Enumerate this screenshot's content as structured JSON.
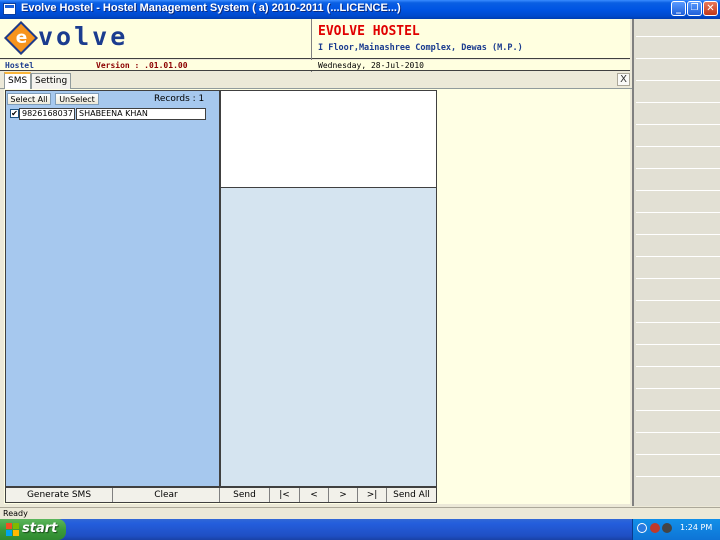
{
  "window": {
    "title": "Evolve Hostel - Hostel Management System ( a) 2010-2011 (...LICENCE...)",
    "minimize": "_",
    "maximize": "❐",
    "close": "✕"
  },
  "header": {
    "logo_initial": "e",
    "logo_text": "volve",
    "company_name": "EVOLVE HOSTEL",
    "company_address": "I Floor,Mainashree Complex, Dewas (M.P.)",
    "module": "Hostel",
    "version": "Version : .01.01.00",
    "date": "Wednesday, 28-Jul-2010"
  },
  "tabs": [
    {
      "label": "SMS",
      "active": true
    },
    {
      "label": "Setting",
      "active": false
    }
  ],
  "tab_close": "X",
  "recipients": {
    "select_all": "Select All",
    "unselect": "UnSelect",
    "records_text": "Records : 1",
    "items": [
      {
        "checked": "✔",
        "phone": "9826168037",
        "name": "SHABEENA KHAN"
      }
    ]
  },
  "buttons": {
    "generate_sms": "Generate SMS",
    "clear": "Clear",
    "send": "Send",
    "first": "|<",
    "prev": "<",
    "next": ">",
    "last": ">|",
    "send_all": "Send All"
  },
  "status": "Ready",
  "taskbar": {
    "start": "start",
    "clock": "1:24 PM"
  },
  "colors": {
    "title_blue": "#0054E3",
    "header_bg": "#FFFFE0",
    "company_red": "#E00000",
    "logo_navy": "#1B3C8F",
    "logo_orange": "#F7941D",
    "recipient_panel": "#A6C8EE",
    "message_list": "#D5E4F0"
  }
}
